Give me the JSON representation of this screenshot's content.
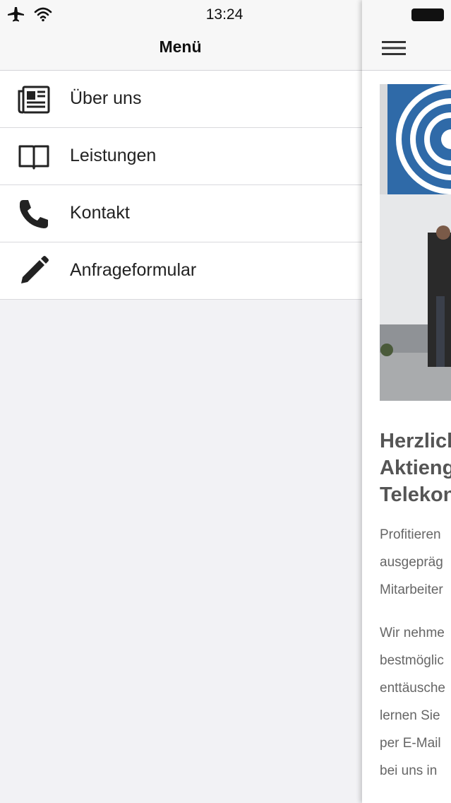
{
  "status_bar": {
    "time": "13:24",
    "airplane_icon": "airplane-icon",
    "wifi_icon": "wifi-icon",
    "battery_icon": "battery-icon"
  },
  "menu": {
    "title": "Menü",
    "items": [
      {
        "label": "Über uns",
        "icon": "newspaper-icon"
      },
      {
        "label": "Leistungen",
        "icon": "book-icon"
      },
      {
        "label": "Kontakt",
        "icon": "phone-icon"
      },
      {
        "label": "Anfrageformular",
        "icon": "pencil-icon"
      }
    ]
  },
  "content": {
    "menu_button_icon": "hamburger-icon",
    "heading": "Herzlich\nAktieng\nTelekon",
    "paragraph1": "Profitieren\nausgepräg\nMitarbeiter",
    "paragraph2": "Wir nehme\nbestmöglic\nenttäusche\nlernen Sie\nper E-Mail\nbei uns in"
  },
  "colors": {
    "menu_background": "#f2f2f5",
    "bar_background": "#f7f7f7",
    "banner_blue": "#2f6aa8"
  }
}
